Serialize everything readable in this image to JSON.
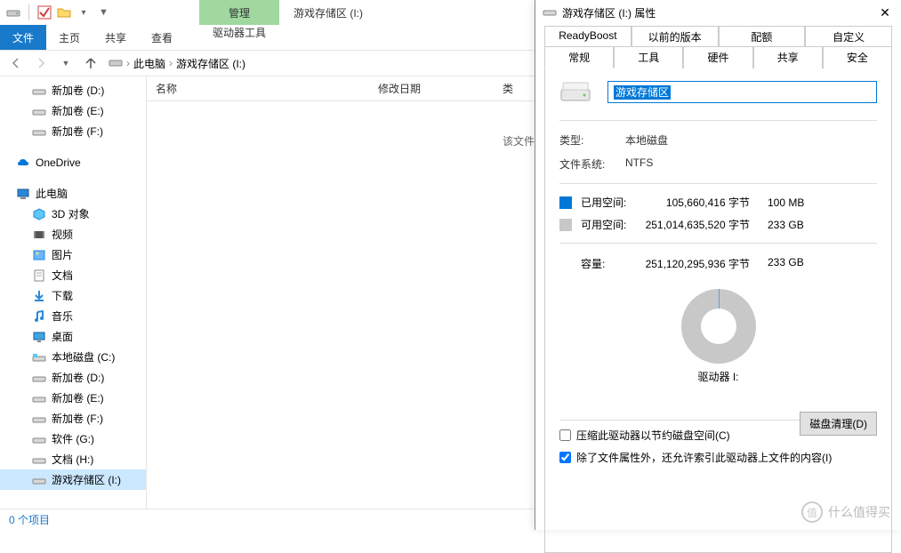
{
  "window": {
    "title": "游戏存储区 (I:)"
  },
  "ribbon": {
    "context_label": "管理",
    "file": "文件",
    "tabs": [
      "主页",
      "共享",
      "查看"
    ],
    "tools": "驱动器工具"
  },
  "breadcrumb": {
    "root": "此电脑",
    "current": "游戏存储区 (I:)"
  },
  "columns": {
    "name": "名称",
    "date": "修改日期",
    "type": "类"
  },
  "empty_message": "该文件夹",
  "tree": {
    "group1": [
      {
        "label": "新加卷 (D:)",
        "icon": "drive"
      },
      {
        "label": "新加卷 (E:)",
        "icon": "drive"
      },
      {
        "label": "新加卷 (F:)",
        "icon": "drive"
      }
    ],
    "onedrive": "OneDrive",
    "thispc": "此电脑",
    "pc_items": [
      {
        "label": "3D 对象",
        "icon": "3d"
      },
      {
        "label": "视频",
        "icon": "video"
      },
      {
        "label": "图片",
        "icon": "pictures"
      },
      {
        "label": "文档",
        "icon": "documents"
      },
      {
        "label": "下载",
        "icon": "downloads"
      },
      {
        "label": "音乐",
        "icon": "music"
      },
      {
        "label": "桌面",
        "icon": "desktop"
      },
      {
        "label": "本地磁盘 (C:)",
        "icon": "drive-sys"
      },
      {
        "label": "新加卷 (D:)",
        "icon": "drive"
      },
      {
        "label": "新加卷 (E:)",
        "icon": "drive"
      },
      {
        "label": "新加卷 (F:)",
        "icon": "drive"
      },
      {
        "label": "软件 (G:)",
        "icon": "drive"
      },
      {
        "label": "文档 (H:)",
        "icon": "drive"
      },
      {
        "label": "游戏存储区 (I:)",
        "icon": "drive",
        "selected": true
      }
    ]
  },
  "statusbar": {
    "items": "0 个项目"
  },
  "properties": {
    "title": "游戏存储区 (I:) 属性",
    "tabs_row1": [
      "ReadyBoost",
      "以前的版本",
      "配额",
      "自定义"
    ],
    "tabs_row2": [
      "常规",
      "工具",
      "硬件",
      "共享",
      "安全"
    ],
    "active_tab": "常规",
    "drive_name": "游戏存储区",
    "type_label": "类型:",
    "type_value": "本地磁盘",
    "fs_label": "文件系统:",
    "fs_value": "NTFS",
    "used_label": "已用空间:",
    "used_bytes": "105,660,416 字节",
    "used_human": "100 MB",
    "used_color": "#0078d7",
    "free_label": "可用空间:",
    "free_bytes": "251,014,635,520 字节",
    "free_human": "233 GB",
    "free_color": "#c8c8c8",
    "cap_label": "容量:",
    "cap_bytes": "251,120,295,936 字节",
    "cap_human": "233 GB",
    "drive_letter": "驱动器 I:",
    "cleanup_btn": "磁盘清理(D)",
    "compress_label": "压缩此驱动器以节约磁盘空间(C)",
    "index_label": "除了文件属性外，还允许索引此驱动器上文件的内容(I)"
  },
  "watermark": "什么值得买"
}
